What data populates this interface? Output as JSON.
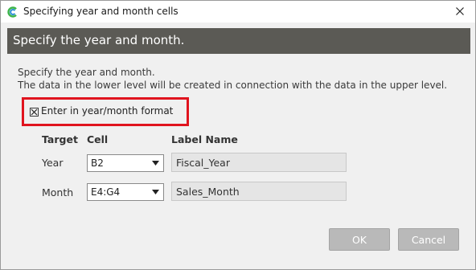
{
  "window": {
    "title": "Specifying year and month cells"
  },
  "header": {
    "text": "Specify the year and month."
  },
  "description": {
    "line1": "Specify the year and month.",
    "line2": "The data in the lower level will be created in connection with the data in the upper level."
  },
  "checkbox": {
    "label": "Enter in year/month format",
    "checked": true
  },
  "columns": {
    "target": "Target",
    "cell": "Cell",
    "label_name": "Label Name"
  },
  "rows": [
    {
      "target": "Year",
      "cell": "B2",
      "label": "Fiscal_Year"
    },
    {
      "target": "Month",
      "cell": "E4:G4",
      "label": "Sales_Month"
    }
  ],
  "buttons": {
    "ok": "OK",
    "cancel": "Cancel"
  },
  "colors": {
    "header_band": "#5b5a55",
    "highlight": "#e0141e",
    "button": "#b9b9b9",
    "app_icon_green": "#3cb44a",
    "app_icon_blue": "#2c8fd6"
  },
  "icons": {
    "app": "app-logo-icon",
    "close": "close-icon",
    "dropdown": "chevron-down-icon",
    "check": "check-mark-icon"
  }
}
